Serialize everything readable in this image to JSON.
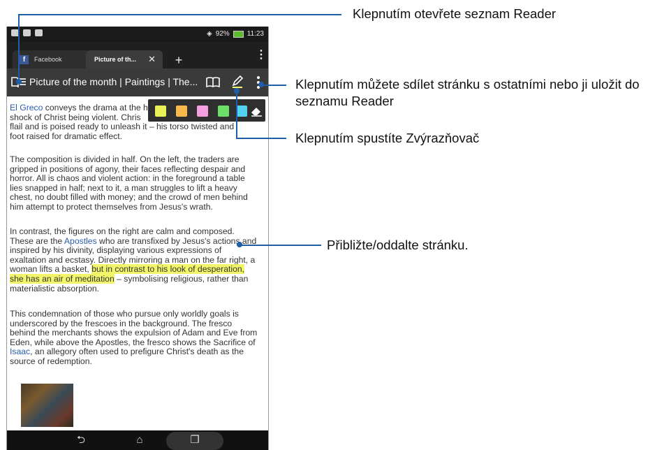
{
  "status": {
    "battery": "92%",
    "time": "11:23"
  },
  "tabs": [
    {
      "label": "Facebook",
      "icon": "f"
    },
    {
      "label": "Picture of th...",
      "close": "✕"
    }
  ],
  "new_tab": "+",
  "toolbar": {
    "title": "Picture of the month | Paintings | The..."
  },
  "palette": {
    "colors": [
      "#e8f257",
      "#f6b94b",
      "#f59fe0",
      "#6ee06a",
      "#52d3f0"
    ]
  },
  "paragraphs": [
    {
      "parts": [
        {
          "text": "El Greco",
          "type": "link"
        },
        {
          "text": " conveys the drama at the h",
          "type": "plain"
        }
      ]
    },
    {
      "parts": [
        {
          "text": "shock of Christ being violent. Chris",
          "type": "plain"
        }
      ]
    },
    {
      "parts": [
        {
          "text": "flail and is poised ready to unleash it – his torso twisted and",
          "type": "plain"
        }
      ]
    },
    {
      "parts": [
        {
          "text": "foot raised for dramatic effect.",
          "type": "plain"
        }
      ]
    }
  ],
  "para2": "The composition is divided in half. On the left, the traders are gripped in positions of agony, their faces reflecting despair and horror. All is chaos and violent action: in the foreground a table lies snapped in half; next to it, a man struggles to lift a heavy chest, no doubt filled with money; and the crowd of men behind him attempt to protect themselves from Jesus's wrath.",
  "para3": {
    "a": "In contrast, the figures on the right are calm and composed. These are the ",
    "link": "Apostles",
    "b": " who are transfixed by Jesus's actions and inspired by his divinity, displaying various expressions of exaltation and ecstasy. Directly mirroring a man on the far right, a woman lifts a basket, ",
    "hl": "but in contrast to his look of desperation, she has an air of meditation",
    "c": " – symbolising religious, rather than materialistic absorption."
  },
  "para4": {
    "a": "This condemnation of those who pursue only worldly goals is underscored by the frescoes in the background. The fresco behind the merchants shows the expulsion of Adam and Eve from Eden, while above the Apostles, the fresco shows the Sacrifice of ",
    "link": "Isaac",
    "b": ", an allegory often used to prefigure Christ's death as the source of redemption."
  },
  "callouts": {
    "reader_list": "Klepnutím otevřete seznam Reader",
    "share": "Klepnutím můžete sdílet stránku s ostatními nebo ji uložit do seznamu Reader",
    "highlighter": "Klepnutím spustíte Zvýrazňovač",
    "zoom": "Přibližte/oddalte stránku."
  },
  "icons": [
    "reader-list-icon",
    "book-icon",
    "highlighter-pen-icon",
    "more-menu-icon",
    "eraser-icon",
    "back-icon",
    "home-icon",
    "recents-icon"
  ]
}
